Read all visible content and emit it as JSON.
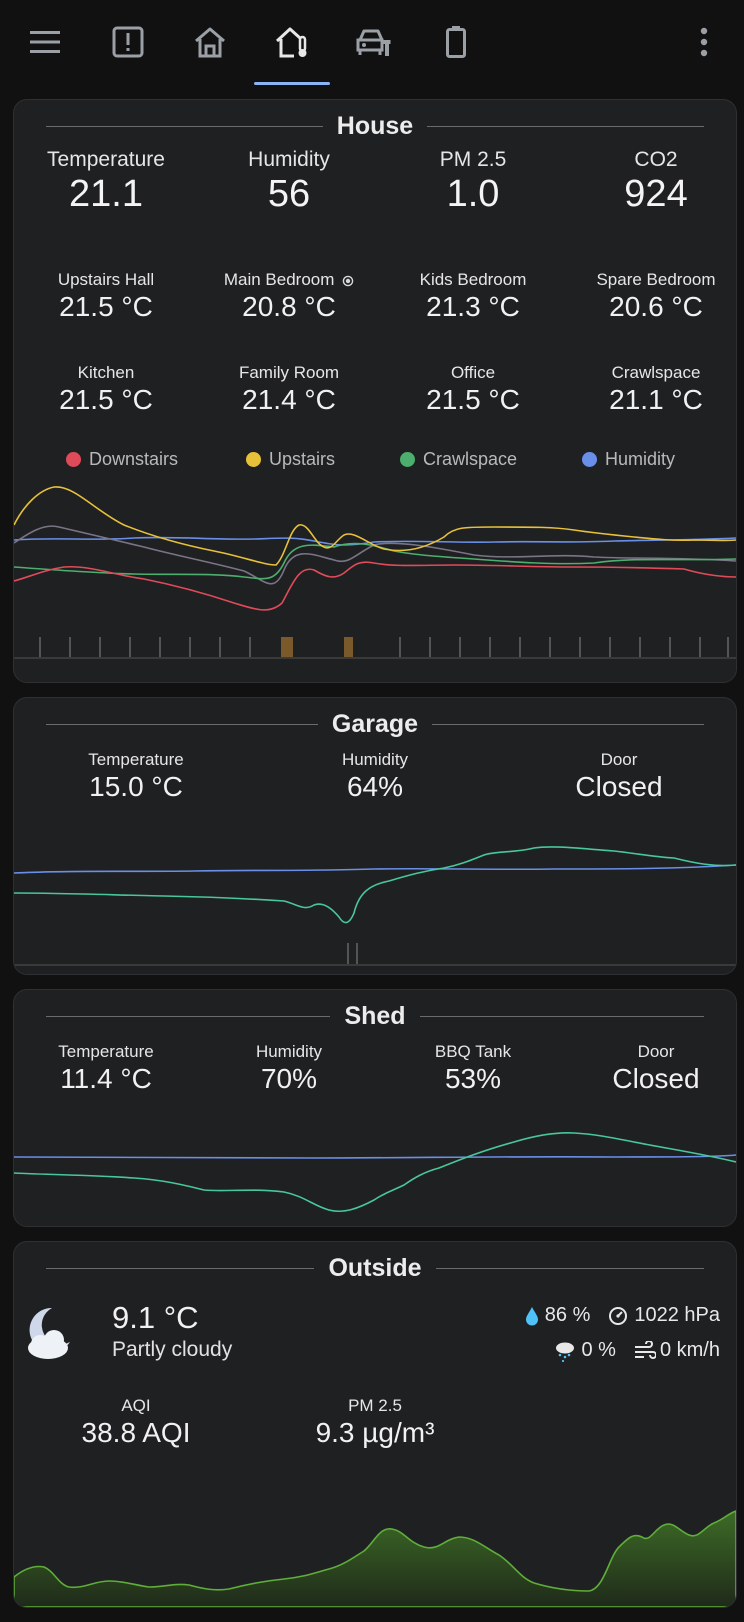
{
  "colors": {
    "background": "#111111",
    "card": "#1f2022",
    "accent": "#8ab4f8",
    "downstairs": "#e04b5a",
    "upstairs": "#e8c13a",
    "crawlspace": "#4caf6e",
    "humidity": "#6a8fe8",
    "gray_series": "#7a7486",
    "green_series": "#48c79a",
    "pm25_fill": "#2e4a1e",
    "pm25_line": "#5fae3a"
  },
  "topbar": {
    "icons": [
      "menu-icon",
      "alert-icon",
      "home-icon",
      "home-thermometer-icon",
      "garage-icon",
      "battery-icon",
      "more-vert-icon"
    ]
  },
  "house": {
    "title": "House",
    "primary": [
      {
        "label": "Temperature",
        "value": "21.1"
      },
      {
        "label": "Humidity",
        "value": "56"
      },
      {
        "label": "PM 2.5",
        "value": "1.0"
      },
      {
        "label": "CO2",
        "value": "924"
      }
    ],
    "rooms": [
      {
        "label": "Upstairs Hall",
        "value": "21.5 °C"
      },
      {
        "label": "Main Bedroom",
        "value": "20.8 °C"
      },
      {
        "label": "Kids Bedroom",
        "value": "21.3 °C"
      },
      {
        "label": "Spare Bedroom",
        "value": "20.6 °C"
      },
      {
        "label": "Kitchen",
        "value": "21.5 °C"
      },
      {
        "label": "Family Room",
        "value": "21.4 °C"
      },
      {
        "label": "Office",
        "value": "21.5 °C"
      },
      {
        "label": "Crawlspace",
        "value": "21.1 °C"
      }
    ],
    "legend": [
      "Downstairs",
      "Upstairs",
      "Crawlspace",
      "Humidity"
    ]
  },
  "garage": {
    "title": "Garage",
    "stats": [
      {
        "label": "Temperature",
        "value": "15.0 °C"
      },
      {
        "label": "Humidity",
        "value": "64%"
      },
      {
        "label": "Door",
        "value": "Closed"
      }
    ]
  },
  "shed": {
    "title": "Shed",
    "stats": [
      {
        "label": "Temperature",
        "value": "11.4 °C"
      },
      {
        "label": "Humidity",
        "value": "70%"
      },
      {
        "label": "BBQ Tank",
        "value": "53%"
      },
      {
        "label": "Door",
        "value": "Closed"
      }
    ]
  },
  "outside": {
    "title": "Outside",
    "temperature": "9.1 °C",
    "condition": "Partly cloudy",
    "humidity": "86 %",
    "pressure": "1022 hPa",
    "precipitation": "0 %",
    "wind": "0 km/h",
    "stats": [
      {
        "label": "AQI",
        "value": "38.8 AQI"
      },
      {
        "label": "PM 2.5",
        "value": "9.3 µg/m³"
      }
    ]
  }
}
